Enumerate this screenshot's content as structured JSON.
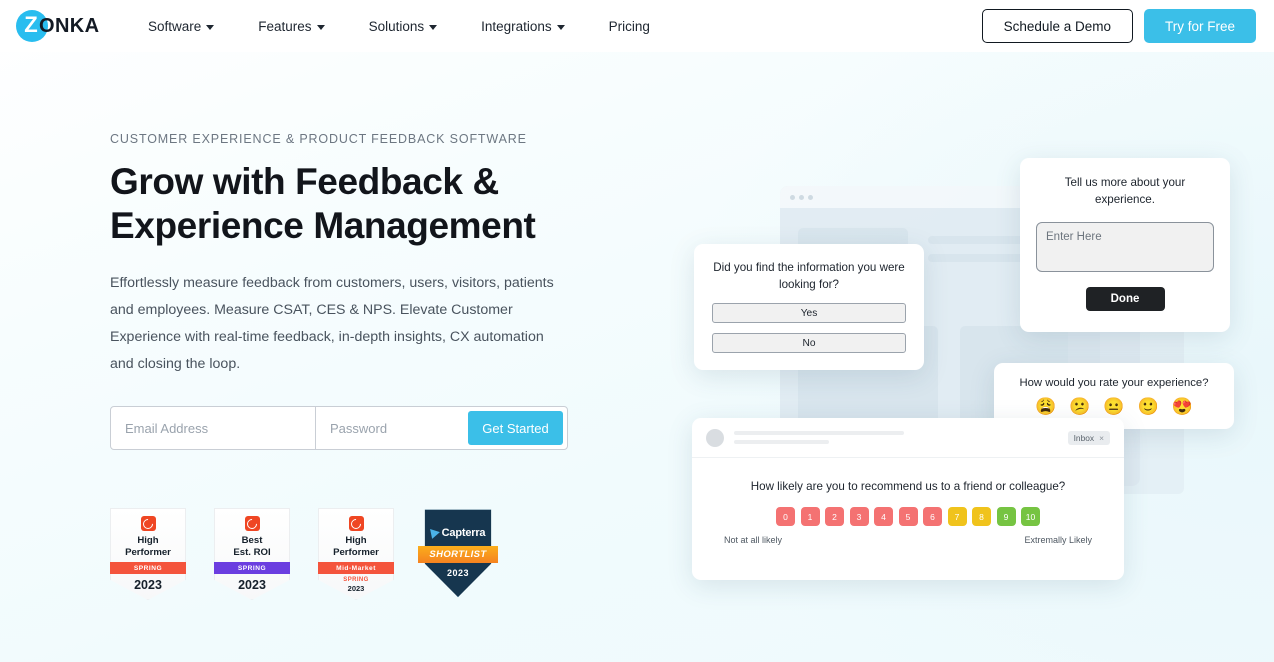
{
  "brand": {
    "logo_letter": "Z",
    "logo_word": "ONKA",
    "accent_blue": "#3bbfe8",
    "logo_circle": "#29bdef"
  },
  "header": {
    "nav": [
      {
        "label": "Software",
        "has_caret": true
      },
      {
        "label": "Features",
        "has_caret": true
      },
      {
        "label": "Solutions",
        "has_caret": true
      },
      {
        "label": "Integrations",
        "has_caret": true
      },
      {
        "label": "Pricing",
        "has_caret": false
      }
    ],
    "demo_button": "Schedule a Demo",
    "try_button": "Try for Free"
  },
  "hero": {
    "eyebrow": "CUSTOMER EXPERIENCE & PRODUCT FEEDBACK SOFTWARE",
    "headline_line1": "Grow with Feedback &",
    "headline_line2": "Experience Management",
    "subcopy": "Effortlessly measure feedback from customers, users, visitors, patients and employees. Measure CSAT, CES & NPS. Elevate Customer Experience with real-time feedback, in-depth insights, CX automation and closing the loop.",
    "signup": {
      "email_placeholder": "Email Address",
      "email_value": "",
      "password_placeholder": "Password",
      "password_value": "",
      "submit_label": "Get Started"
    }
  },
  "badges": [
    {
      "type": "g2",
      "title_line1": "High",
      "title_line2": "Performer",
      "ribbon": "SPRING",
      "ribbon_color": "red",
      "sub2": "",
      "year": "2023",
      "year_small": false
    },
    {
      "type": "g2",
      "title_line1": "Best",
      "title_line2": "Est. ROI",
      "ribbon": "SPRING",
      "ribbon_color": "purple",
      "sub2": "",
      "year": "2023",
      "year_small": false
    },
    {
      "type": "g2",
      "title_line1": "High",
      "title_line2": "Performer",
      "ribbon": "Mid-Market",
      "ribbon_color": "red",
      "sub2": "SPRING",
      "year": "2023",
      "year_small": true
    },
    {
      "type": "capterra",
      "name": "Capterra",
      "ribbon": "SHORTLIST",
      "year": "2023"
    }
  ],
  "illustration": {
    "card_yesno": {
      "question": "Did you find the information you were looking for?",
      "options": [
        "Yes",
        "No"
      ]
    },
    "card_text": {
      "question": "Tell us more about your experience.",
      "textarea_placeholder": "Enter Here",
      "textarea_value": "",
      "submit_label": "Done"
    },
    "card_emoji": {
      "question": "How would you rate your experience?",
      "emojis": [
        "😩",
        "😕",
        "😐",
        "🙂",
        "😍"
      ],
      "emoji_names": [
        "weary-face",
        "confused-face",
        "neutral-face",
        "slightly-smiling-face",
        "heart-eyes-face"
      ]
    },
    "card_nps": {
      "inbox_tag": "Inbox",
      "inbox_close": "×",
      "question": "How likely are you to recommend us to a friend or colleague?",
      "scale": [
        {
          "value": "0",
          "color": "#f47272"
        },
        {
          "value": "1",
          "color": "#f47272"
        },
        {
          "value": "2",
          "color": "#f47272"
        },
        {
          "value": "3",
          "color": "#f47272"
        },
        {
          "value": "4",
          "color": "#f47272"
        },
        {
          "value": "5",
          "color": "#f47272"
        },
        {
          "value": "6",
          "color": "#f47272"
        },
        {
          "value": "7",
          "color": "#f0c31c"
        },
        {
          "value": "8",
          "color": "#f0c31c"
        },
        {
          "value": "9",
          "color": "#76c442"
        },
        {
          "value": "10",
          "color": "#76c442"
        }
      ],
      "left_label": "Not at all likely",
      "right_label": "Extremally Likely"
    }
  }
}
